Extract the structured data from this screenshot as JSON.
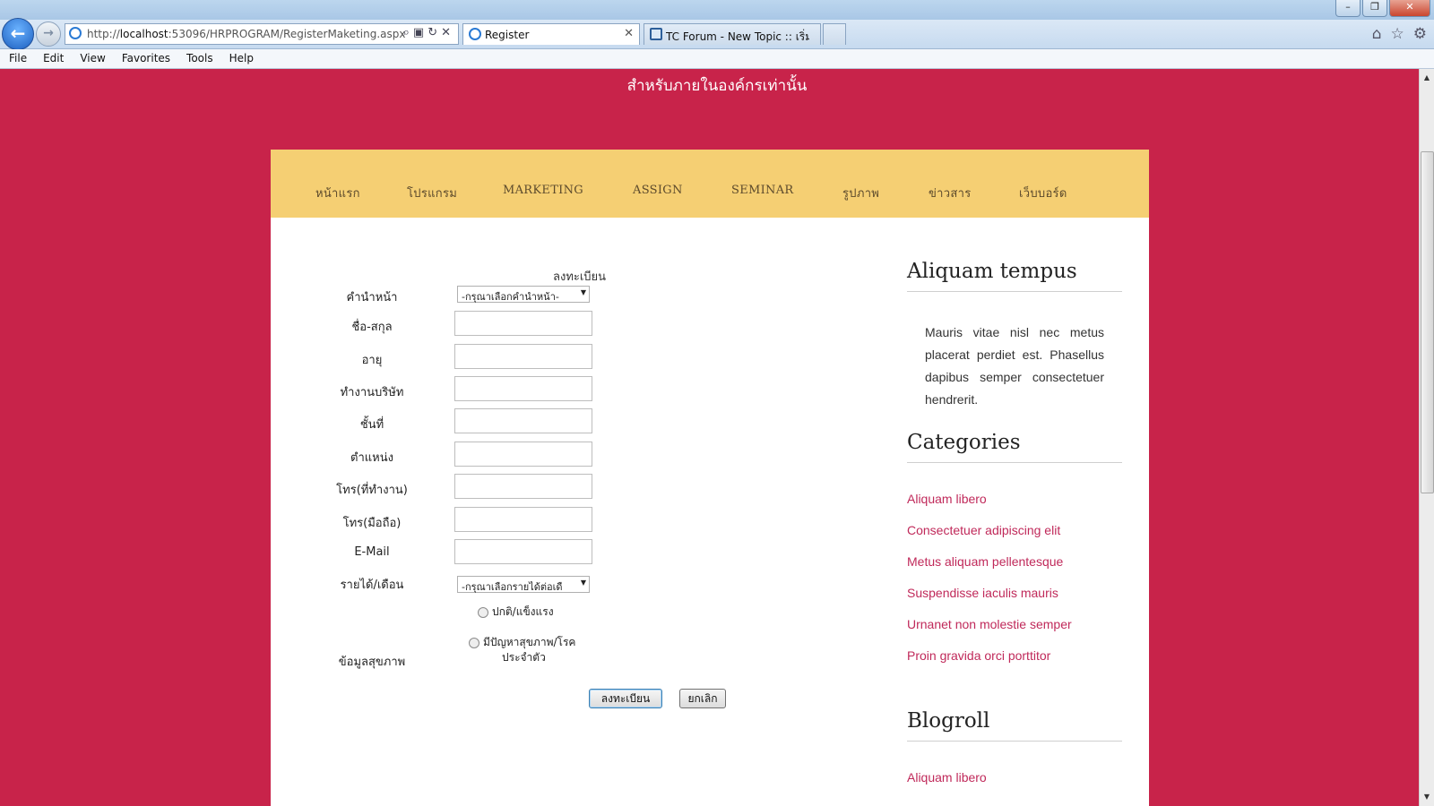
{
  "browser": {
    "address_protocol": "http://",
    "address_host": "localhost",
    "address_path": ":53096/HRPROGRAM/RegisterMaketing.aspx",
    "tabs": [
      {
        "label": "Register",
        "active": true
      },
      {
        "label": "TC Forum - New Topic :: เริ่มก...",
        "active": false
      }
    ],
    "menu": [
      "File",
      "Edit",
      "View",
      "Favorites",
      "Tools",
      "Help"
    ]
  },
  "page": {
    "slogan": "สำหรับภายในองค์กรเท่านั้น",
    "nav": [
      "หน้าแรก",
      "โปรแกรม",
      "MARKETING",
      "ASSIGN",
      "SEMINAR",
      "รูปภาพ",
      "ข่าวสาร",
      "เว็บบอร์ด"
    ]
  },
  "form": {
    "title": "ลงทะเบียน",
    "labels": {
      "prefix": "คำนำหน้า",
      "fullname": "ชื่อ-สกุล",
      "age": "อายุ",
      "company": "ทำงานบริษัท",
      "floor": "ชั้นที่",
      "position": "ตำแหน่ง",
      "phone_work": "โทร(ที่ทำงาน)",
      "phone_mobile": "โทร(มือถือ)",
      "email": "E-Mail",
      "income": "รายได้/เดือน",
      "health": "ข้อมูลสุขภาพ"
    },
    "prefix_select": "-กรุณาเลือกคำนำหน้า-",
    "income_select": "-กรุณาเลือกรายได้ต่อเดื",
    "health_options": [
      "ปกติ/แข็งแรง",
      "มีปัญหาสุขภาพ/โรค",
      "ประจำตัว"
    ],
    "submit_label": "ลงทะเบียน",
    "cancel_label": "ยกเลิก"
  },
  "sidebar": {
    "heading1": "Aliquam tempus",
    "paragraph": "Mauris vitae nisl nec metus placerat perdiet est. Phasellus dapibus semper consectetuer hendrerit.",
    "heading2": "Categories",
    "categories": [
      "Aliquam libero",
      "Consectetuer adipiscing elit",
      "Metus aliquam pellentesque",
      "Suspendisse iaculis mauris",
      "Urnanet non molestie semper",
      "Proin gravida orci porttitor"
    ],
    "heading3": "Blogroll",
    "blogroll": [
      "Aliquam libero"
    ]
  },
  "colors": {
    "page_bg": "#c8234a",
    "nav_bg": "#f5cf73",
    "link": "#c0295a"
  }
}
